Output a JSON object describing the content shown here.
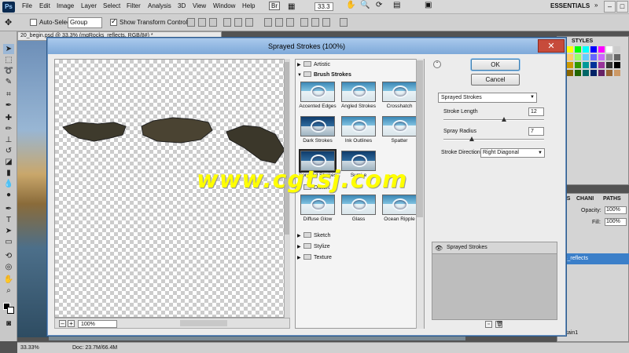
{
  "menubar": {
    "app_badge": "Ps",
    "items": [
      "File",
      "Edit",
      "Image",
      "Layer",
      "Select",
      "Filter",
      "Analysis",
      "3D",
      "View",
      "Window",
      "Help"
    ],
    "bridge_badge": "Br",
    "zoom_value": "33.3",
    "workspace": "ESSENTIALS"
  },
  "options": {
    "auto_select_label": "Auto-Select:",
    "auto_select_value": "Group",
    "show_transform_label": "Show Transform Controls"
  },
  "document": {
    "tab_title": "20_begin.psd @ 33.3% (mqRocks_reflects, RGB/8#) *",
    "status_zoom": "33.33%",
    "status_doc": "Doc: 23.7M/66.4M"
  },
  "dialog": {
    "title": "Sprayed Strokes (100%)",
    "preview_zoom": "100%",
    "ok_label": "OK",
    "cancel_label": "Cancel",
    "folders": {
      "artistic": "Artistic",
      "brush_strokes": "Brush Strokes",
      "distort": "Distort",
      "sketch": "Sketch",
      "stylize": "Stylize",
      "texture": "Texture"
    },
    "brush_thumbs": [
      "Accented Edges",
      "Angled Strokes",
      "Crosshatch",
      "Dark Strokes",
      "Ink Outlines",
      "Spatter",
      "Sprayed Strokes",
      "Sumi-e"
    ],
    "distort_thumbs": [
      "Diffuse Glow",
      "Glass",
      "Ocean Ripple"
    ],
    "filter_select": "Sprayed Strokes",
    "stroke_length_label": "Stroke Length",
    "stroke_length_value": "12",
    "stroke_length_fraction": 0.6,
    "spray_radius_label": "Spray Radius",
    "spray_radius_value": "7",
    "spray_radius_fraction": 0.28,
    "direction_label": "Stroke Direction:",
    "direction_value": "Right Diagonal",
    "effect_layer": "Sprayed Strokes"
  },
  "panels": {
    "styles_tab": "STYLES",
    "layers_tab": "ERS",
    "channels_tab": "CHANI",
    "paths_tab": "PATHS",
    "opacity_label": "Opacity:",
    "opacity_value": "100%",
    "fill_label": "Fill:",
    "fill_value": "100%",
    "layer_name_partial": "s_reflects",
    "layer_name_partial2": "tain1"
  },
  "watermark": "www.cgtsj.com",
  "colors": {
    "dialog_title_bg": "#a9c9ec",
    "close_red": "#c74b3b",
    "layer_selected": "#3b7fc9",
    "watermark": "#ffff00"
  }
}
